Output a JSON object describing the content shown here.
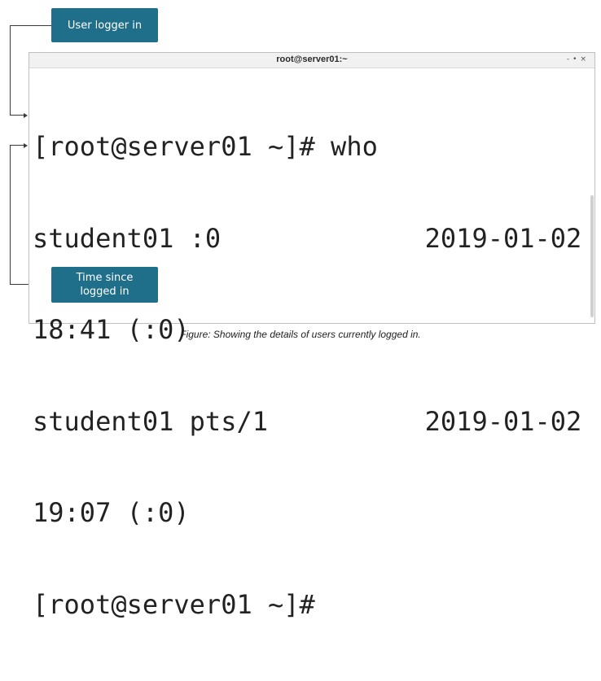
{
  "callouts": {
    "user_logged_in": "User logger in",
    "time_since_line1": "Time since",
    "time_since_line2": "logged in"
  },
  "window": {
    "title": "root@server01:~",
    "controls": [
      "-",
      "•",
      "×"
    ]
  },
  "terminal": {
    "lines": [
      "[root@server01 ~]# who",
      "student01 :0             2019-01-02",
      "18:41 (:0)",
      "student01 pts/1          2019-01-02",
      "19:07 (:0)",
      "[root@server01 ~]#"
    ]
  },
  "caption": "Figure: Showing the details of users currently logged in.",
  "colors": {
    "callout_bg": "#1f6f8b",
    "terminal_text": "#222222"
  }
}
